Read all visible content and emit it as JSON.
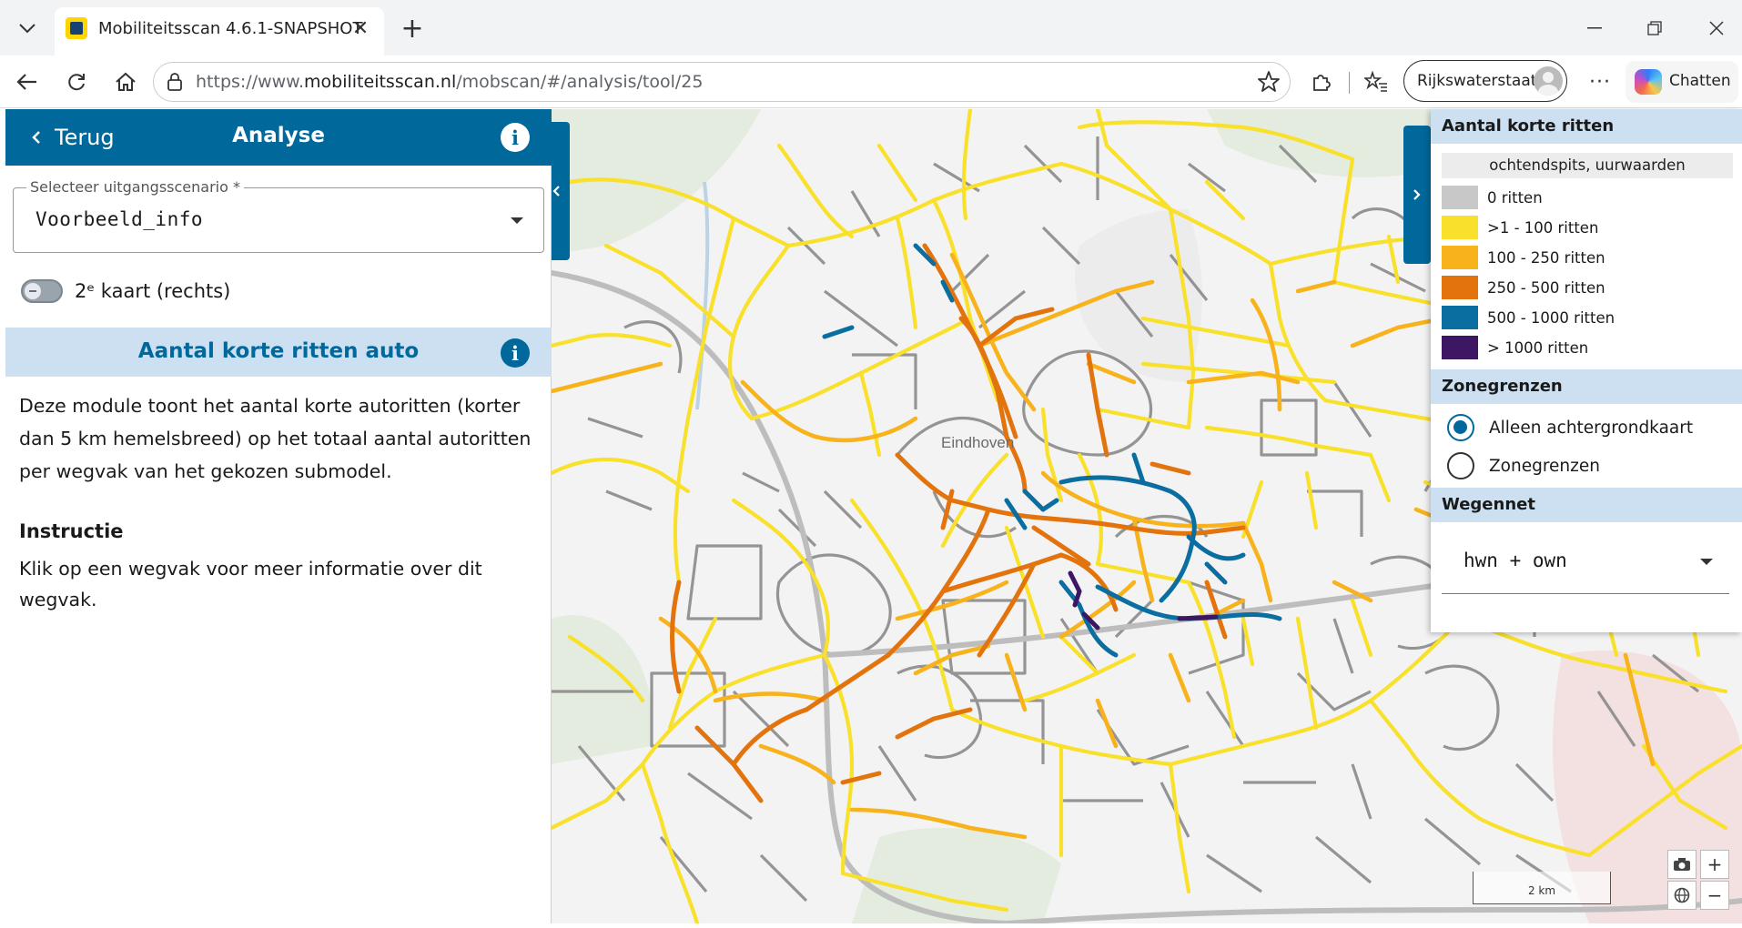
{
  "browser": {
    "tab_title": "Mobiliteitsscan 4.6.1-SNAPSHOT",
    "url_prefix": "https://www.",
    "url_host": "mobiliteitsscan.nl",
    "url_path": "/mobscan/#/analysis/tool/25",
    "profile_name": "Rijkswaterstaat",
    "copilot_label": "Chatten"
  },
  "sidebar": {
    "back_label": "Terug",
    "title": "Analyse",
    "scenario_label": "Selecteer uitgangsscenario *",
    "scenario_value": "Voorbeeld_info",
    "toggle_label": "2ᵉ kaart (rechts)",
    "module_title": "Aantal korte ritten auto",
    "description": "Deze module toont het aantal korte autoritten (korter dan 5 km hemelsbreed) op het totaal aantal autoritten per wegvak van het gekozen submodel.",
    "instruction_title": "Instructie",
    "instruction_text": "Klik op een wegvak voor meer informatie over dit wegvak."
  },
  "legend": {
    "title": "Aantal korte ritten",
    "period": "ochtendspits, uurwaarden",
    "classes": [
      {
        "label": "0 ritten",
        "color": "#c8c8c8"
      },
      {
        "label": ">1 - 100 ritten",
        "color": "#f9e02a"
      },
      {
        "label": "100 - 250 ritten",
        "color": "#f7b21c"
      },
      {
        "label": "250 - 500 ritten",
        "color": "#e2730d"
      },
      {
        "label": "500 - 1000 ritten",
        "color": "#0b6ea0"
      },
      {
        "label": "> 1000 ritten",
        "color": "#3d1664"
      }
    ],
    "zone_title": "Zonegrenzen",
    "zone_options": [
      "Alleen achtergrondkaart",
      "Zonegrenzen"
    ],
    "zone_selected": "Alleen achtergrondkaart",
    "network_title": "Wegennet",
    "network_value": "hwn + own"
  },
  "map": {
    "city_label": "Eindhoven",
    "scale_label": "2 km",
    "icons": [
      "camera-icon",
      "globe-icon",
      "zoom-in-icon",
      "zoom-out-icon"
    ]
  }
}
